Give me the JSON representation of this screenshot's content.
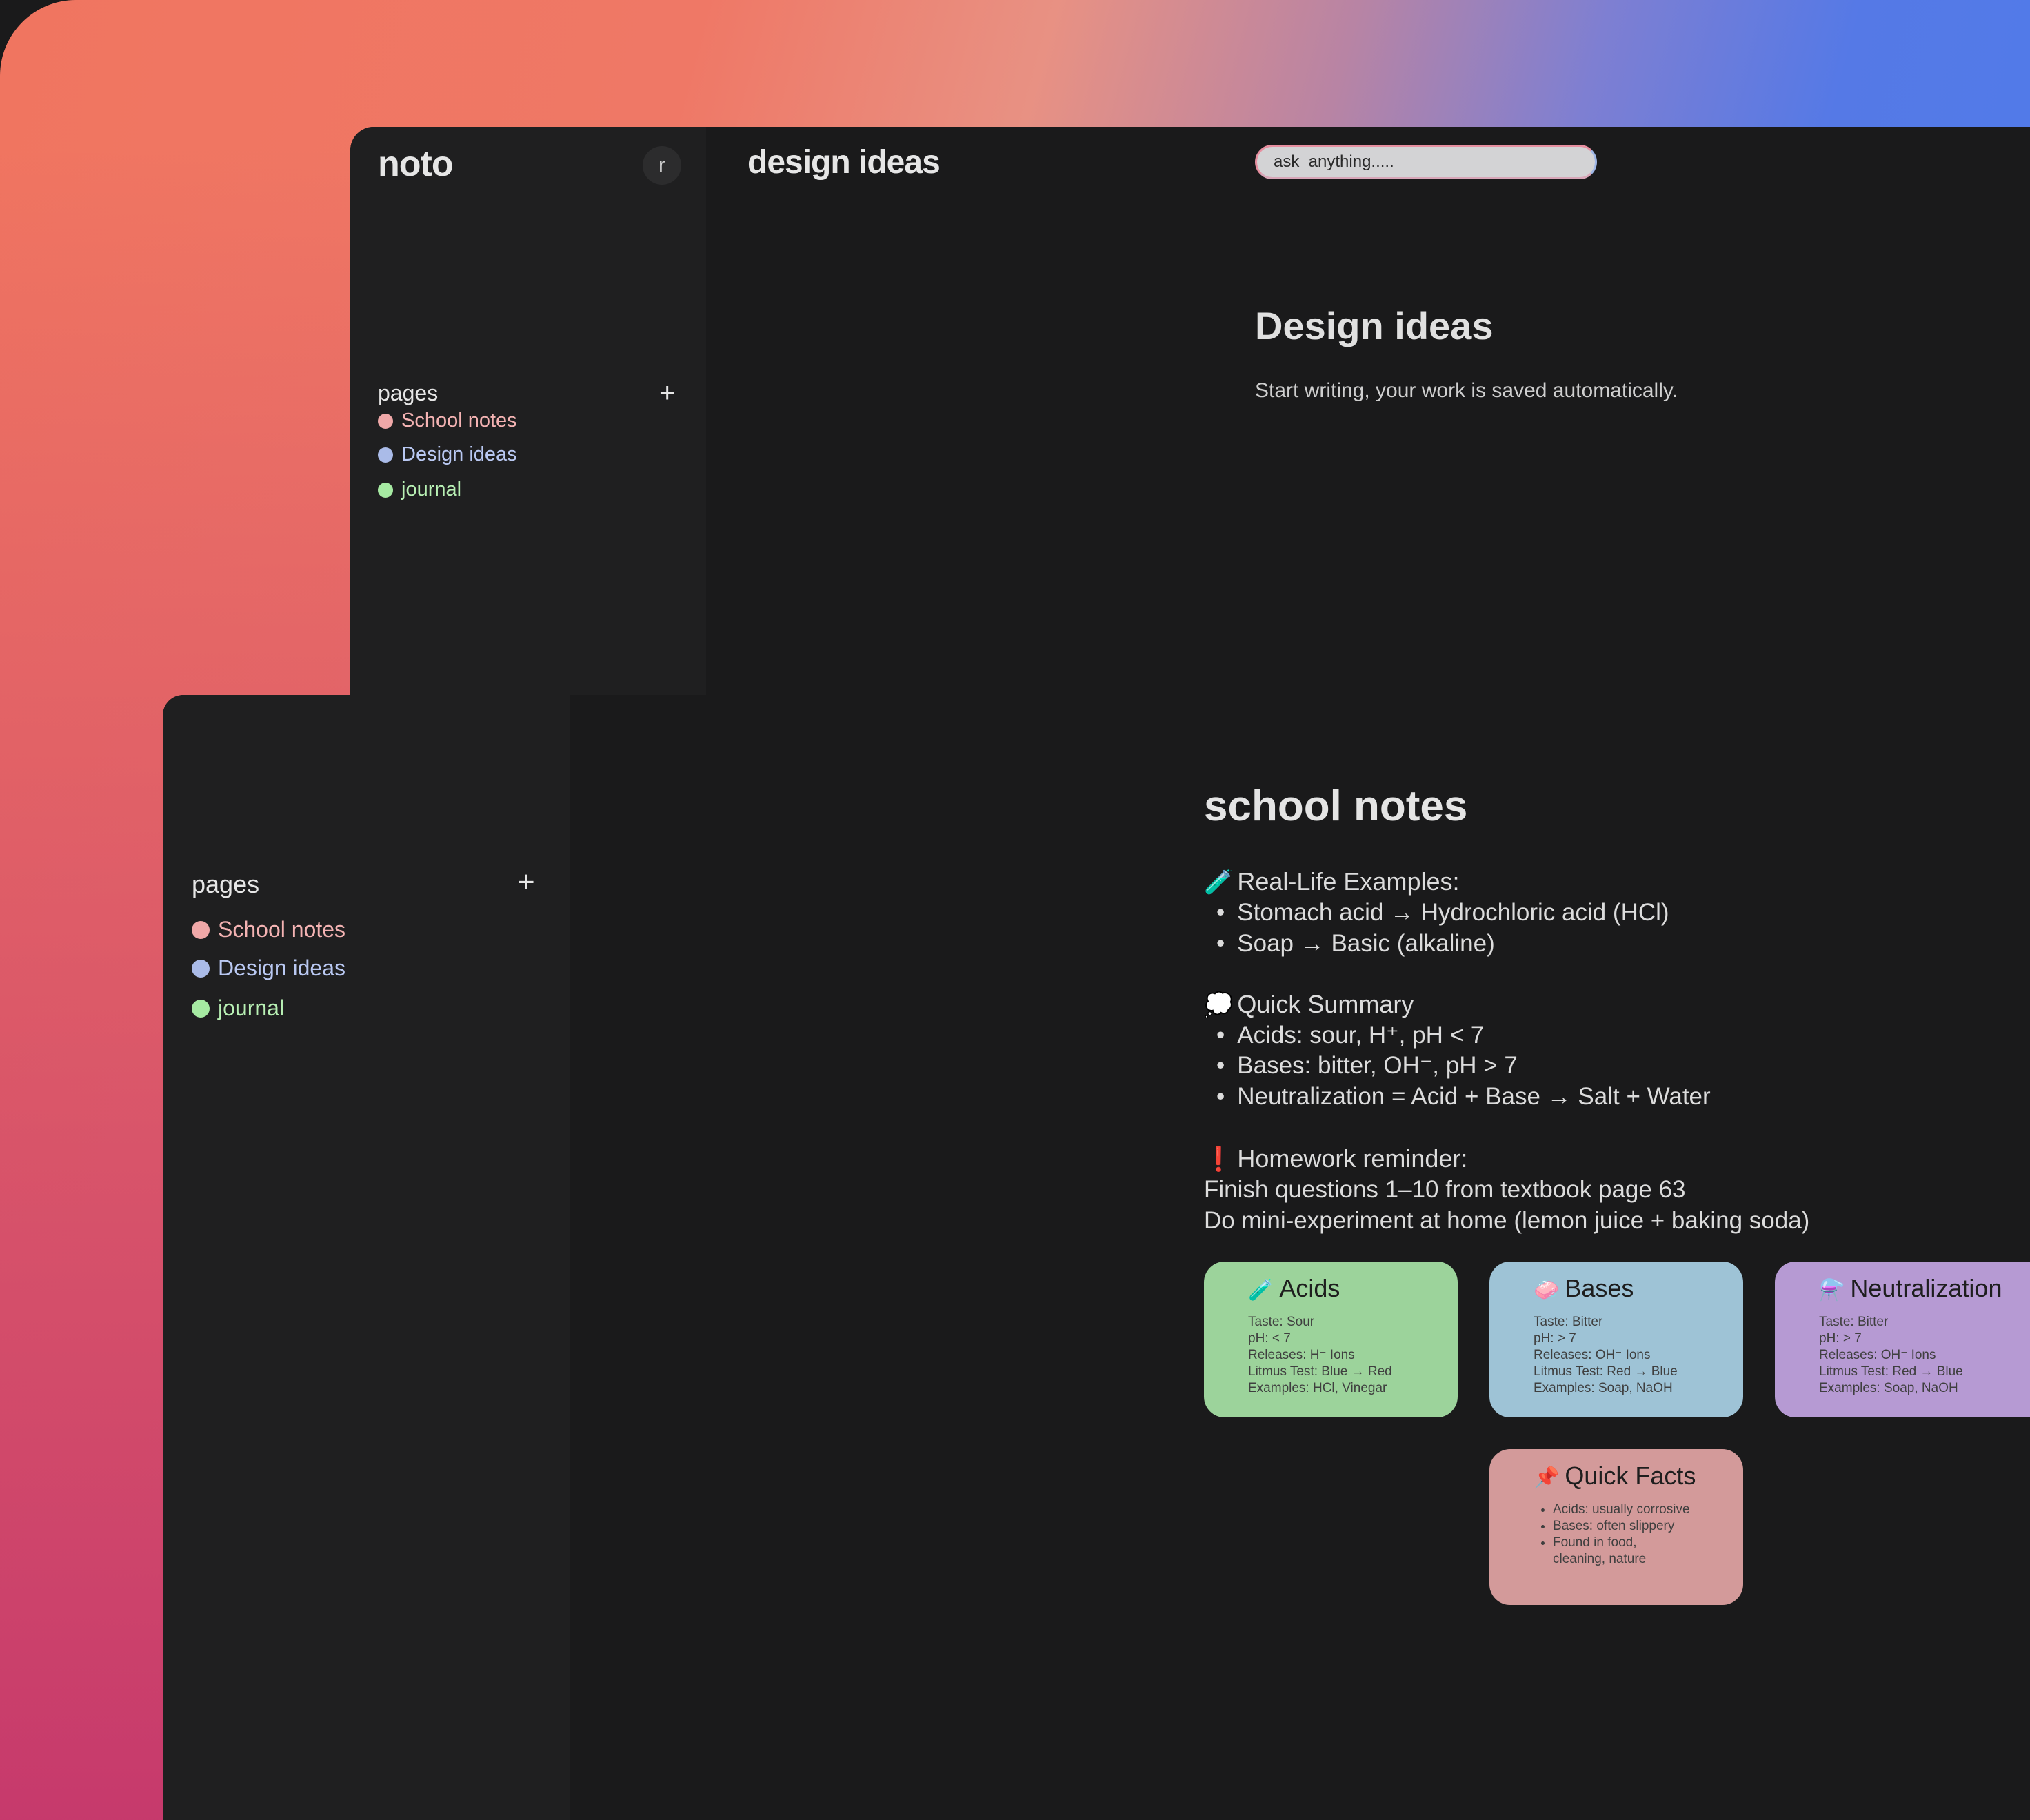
{
  "app": {
    "name": "noto",
    "avatar_letter": "r"
  },
  "sidebar": {
    "pages_label": "pages",
    "add_label": "+",
    "items": [
      {
        "label": "School notes",
        "color": "#f4b3b3"
      },
      {
        "label": "Design ideas",
        "color": "#b9c8f2"
      },
      {
        "label": "journal",
        "color": "#b8f0b4"
      }
    ]
  },
  "back_window": {
    "header": "design ideas",
    "search_placeholder": "ask  anything.....",
    "doc_title": "Design ideas",
    "doc_subtitle": "Start writing, your work is saved automatically."
  },
  "front_window": {
    "title": "school notes",
    "sections": [
      {
        "icon": "test-tube-icon",
        "emoji": "🧪",
        "heading": "Real-Life Examples:",
        "bullets": [
          "Stomach acid → Hydrochloric acid (HCl)",
          "Soap → Basic (alkaline)"
        ]
      },
      {
        "icon": "cloud-icon",
        "emoji": "💭",
        "heading": "Quick Summary",
        "bullets": [
          "Acids: sour, H⁺, pH < 7",
          "Bases: bitter, OH⁻, pH > 7",
          "Neutralization = Acid + Base → Salt + Water"
        ]
      },
      {
        "icon": "exclamation-icon",
        "emoji": "❗",
        "heading": "Homework reminder:",
        "lines": [
          "Finish questions 1–10 from textbook page 63",
          "Do mini-experiment at home (lemon juice + baking soda)"
        ]
      }
    ],
    "cards": [
      {
        "icon": "test-tube-icon",
        "emoji": "🧪",
        "title": "Acids",
        "color": "#9cd39b",
        "lines": [
          "Taste: Sour",
          "pH: < 7",
          "Releases: H⁺ Ions",
          "Litmus Test: Blue → Red",
          "Examples: HCl, Vinegar"
        ]
      },
      {
        "icon": "soap-icon",
        "emoji": "🧼",
        "title": "Bases",
        "color": "#9ec3d6",
        "lines": [
          "Taste: Bitter",
          "pH: > 7",
          "Releases: OH⁻ Ions",
          "Litmus Test: Red → Blue",
          "Examples: Soap, NaOH"
        ]
      },
      {
        "icon": "flask-icon",
        "emoji": "⚗️",
        "title": "Neutralization",
        "color": "#b69ad3",
        "lines": [
          "Taste: Bitter",
          "pH: > 7",
          "Releases: OH⁻ Ions",
          "Litmus Test: Red → Blue",
          "Examples: Soap, NaOH"
        ]
      },
      {
        "icon": "pushpin-icon",
        "emoji": "📌",
        "title": "Quick Facts",
        "color": "#d39a9a",
        "bullets": [
          "Acids: usually corrosive",
          "Bases: often slippery",
          "Found in food, cleaning, nature"
        ]
      }
    ]
  }
}
